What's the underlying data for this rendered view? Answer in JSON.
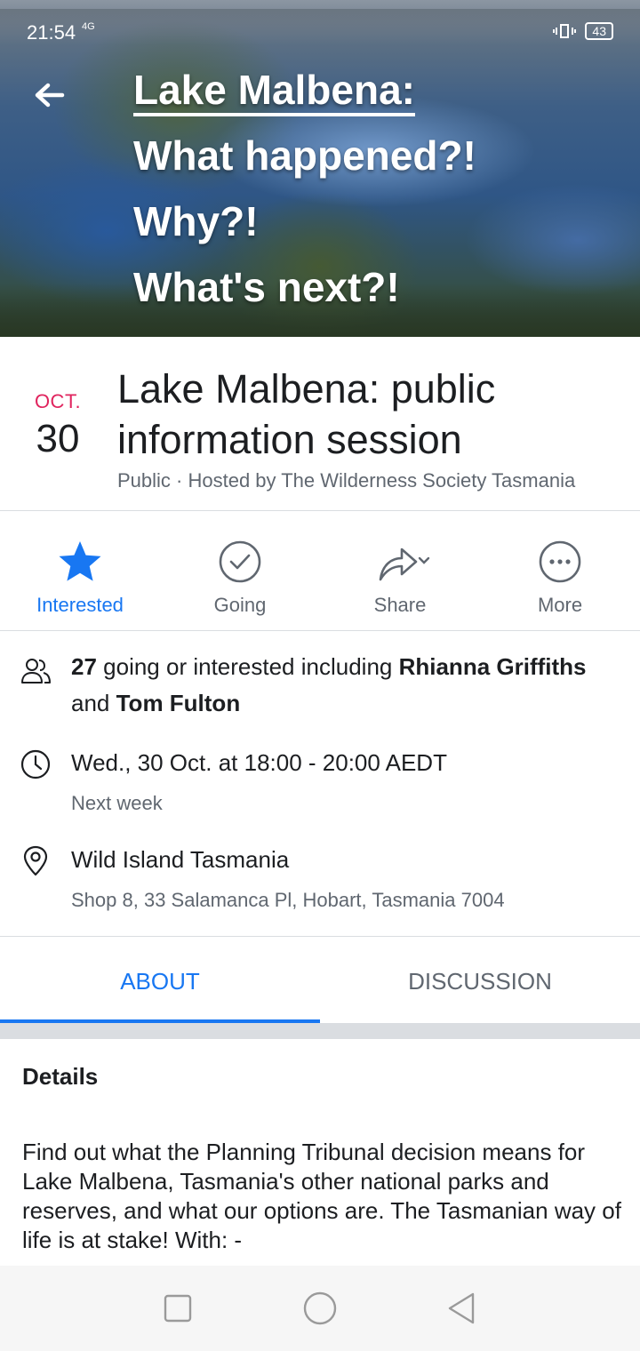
{
  "status_bar": {
    "time": "21:54",
    "network": "4G",
    "battery": "43"
  },
  "cover": {
    "title_line1": "Lake Malbena:",
    "title_line2": "What happened?!",
    "title_line3": "Why?!",
    "title_line4": "What's next?!"
  },
  "event": {
    "month": "OCT.",
    "day": "30",
    "title": "Lake Malbena: public information session",
    "subtitle": "Public · Hosted by The Wilderness Society Tasmania"
  },
  "actions": [
    {
      "label": "Interested",
      "icon": "star-icon",
      "active": true
    },
    {
      "label": "Going",
      "icon": "check-circle-icon"
    },
    {
      "label": "Share",
      "icon": "share-icon"
    },
    {
      "label": "More",
      "icon": "more-icon"
    }
  ],
  "attendance": {
    "count": "27",
    "text_before": " going or interested including ",
    "person1": "Rhianna Griffiths",
    "text_and": "and ",
    "person2": "Tom Fulton"
  },
  "time_info": {
    "main": "Wed., 30 Oct. at 18:00 - 20:00 AEDT",
    "sub": "Next week"
  },
  "location": {
    "name": "Wild Island Tasmania",
    "address": "Shop 8, 33 Salamanca Pl, Hobart, Tasmania 7004"
  },
  "tabs": [
    {
      "label": "ABOUT",
      "active": true
    },
    {
      "label": "DISCUSSION"
    }
  ],
  "details": {
    "heading": "Details",
    "body": "Find out what the Planning Tribunal decision means for Lake Malbena, Tasmania's other national parks and reserves, and what our options are. The Tasmanian way of life is at stake! With: -"
  },
  "colors": {
    "accent": "#1877f2",
    "date_red": "#e0245e",
    "secondary_text": "#606770"
  }
}
